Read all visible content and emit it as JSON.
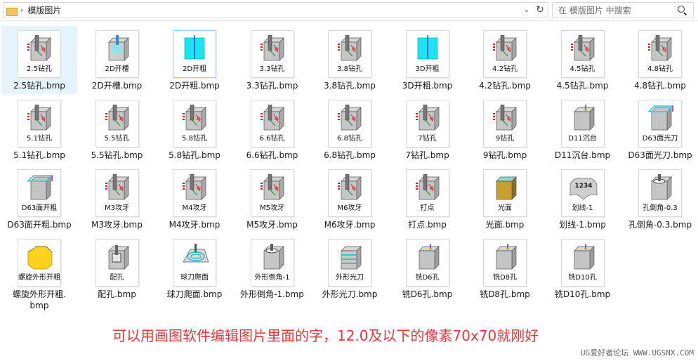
{
  "address": {
    "folder": "模版图片"
  },
  "search": {
    "placeholder": "在 模版图片 中搜索"
  },
  "files": [
    {
      "caption": "2.5钻孔",
      "name": "2.5钻孔.bmp",
      "kind": "drill",
      "selected": true
    },
    {
      "caption": "2D开槽",
      "name": "2D开槽.bmp",
      "kind": "slot"
    },
    {
      "caption": "2D开粗",
      "name": "2D开粗.bmp",
      "kind": "rough-cyan",
      "focused": true
    },
    {
      "caption": "3.3钻孔",
      "name": "3.3钻孔.bmp",
      "kind": "drill"
    },
    {
      "caption": "3.8钻孔",
      "name": "3.8钻孔.bmp",
      "kind": "drill"
    },
    {
      "caption": "3D开粗",
      "name": "3D开粗.bmp",
      "kind": "rough-cyan"
    },
    {
      "caption": "4.2钻孔",
      "name": "4.2钻孔.bmp",
      "kind": "drill"
    },
    {
      "caption": "4.5钻孔",
      "name": "4.5钻孔.bmp",
      "kind": "drill"
    },
    {
      "caption": "4.8钻孔",
      "name": "4.8钻孔.bmp",
      "kind": "drill"
    },
    {
      "caption": "5.1钻孔",
      "name": "5.1钻孔.bmp",
      "kind": "drill"
    },
    {
      "caption": "5.5钻孔",
      "name": "5.5钻孔.bmp",
      "kind": "drill"
    },
    {
      "caption": "5.8钻孔",
      "name": "5.8钻孔.bmp",
      "kind": "drill"
    },
    {
      "caption": "6.6钻孔",
      "name": "6.6钻孔.bmp",
      "kind": "drill"
    },
    {
      "caption": "6.8钻孔",
      "name": "6.8钻孔.bmp",
      "kind": "drill"
    },
    {
      "caption": "7钻孔",
      "name": "7钻孔.bmp",
      "kind": "drill"
    },
    {
      "caption": "9钻孔",
      "name": "9钻孔.bmp",
      "kind": "drill"
    },
    {
      "caption": "D11沉台",
      "name": "D11沉台.bmp",
      "kind": "cube"
    },
    {
      "caption": "D63面光刀",
      "name": "D63面光刀.bmp",
      "kind": "face"
    },
    {
      "caption": "D63面开粗",
      "name": "D63面开粗.bmp",
      "kind": "face"
    },
    {
      "caption": "M3攻牙",
      "name": "M3攻牙.bmp",
      "kind": "drill"
    },
    {
      "caption": "M4攻牙",
      "name": "M4攻牙.bmp",
      "kind": "drill"
    },
    {
      "caption": "M5攻牙",
      "name": "M5攻牙.bmp",
      "kind": "drill"
    },
    {
      "caption": "M6攻牙",
      "name": "M6攻牙.bmp",
      "kind": "drill"
    },
    {
      "caption": "打点",
      "name": "打点.bmp",
      "kind": "drill"
    },
    {
      "caption": "光面",
      "name": "光面.bmp",
      "kind": "gold"
    },
    {
      "caption": "划线-1",
      "name": "划线-1.bmp",
      "kind": "engrave",
      "text": "1234"
    },
    {
      "caption": "孔倒角-0.3",
      "name": "孔倒角-0.3.bmp",
      "kind": "chamfer"
    },
    {
      "caption": "螺旋外形开粗",
      "name": "螺旋外形开粗.bmp",
      "kind": "yellow"
    },
    {
      "caption": "配孔",
      "name": "配孔.bmp",
      "kind": "pocket"
    },
    {
      "caption": "球刀爬面",
      "name": "球刀爬面.bmp",
      "kind": "ball"
    },
    {
      "caption": "外形倒角-1",
      "name": "外形倒角-1.bmp",
      "kind": "chamfer"
    },
    {
      "caption": "外形光刀",
      "name": "外形光刀.bmp",
      "kind": "contour"
    },
    {
      "caption": "铣D6孔",
      "name": "铣D6孔.bmp",
      "kind": "cube"
    },
    {
      "caption": "铣D8孔",
      "name": "铣D8孔.bmp",
      "kind": "cube"
    },
    {
      "caption": "铣D10孔",
      "name": "铣D10孔.bmp",
      "kind": "cube"
    }
  ],
  "wrapped_name": {
    "line1": "螺旋外形开粗.",
    "line2": "bmp"
  },
  "banner": "可以用画图软件编辑图片里面的字，12.0及以下的像素70x70就刚好",
  "watermark": "UG爱好者论坛 WWW.UGSNX.COM",
  "colors": {
    "banner": "#e8363a",
    "selection": "#e5f3ff",
    "cyan": "#1fe3f0",
    "gold": "#c8a032",
    "yellow": "#ffd21f"
  }
}
